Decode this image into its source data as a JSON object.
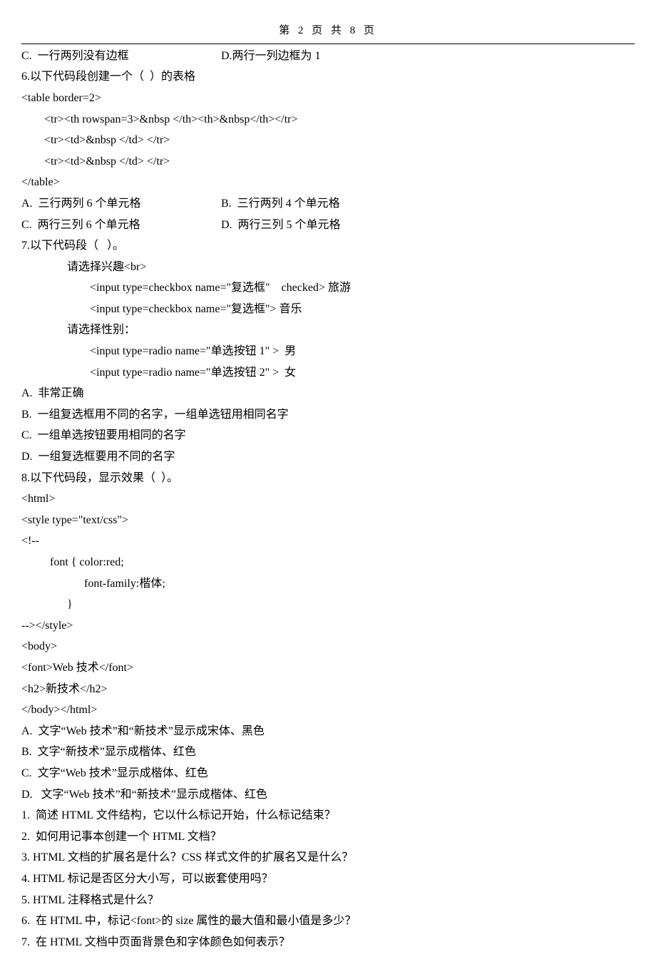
{
  "header": "第 2 页 共 8 页",
  "l1a": "C.  一行两列没有边框",
  "l1b": "D.两行一列边框为 1",
  "l2": "6.以下代码段创建一个（  ）的表格",
  "l3": "<table border=2>",
  "l4": "<tr><th rowspan=3>&nbsp </th><th>&nbsp</th></tr>",
  "l5": "<tr><td>&nbsp </td> </tr>",
  "l6": "<tr><td>&nbsp </td> </tr>",
  "l7": "</table>",
  "l8a": "A.  三行两列 6 个单元格",
  "l8b": "B.  三行两列 4 个单元格",
  "l9a": "C.  两行三列 6 个单元格",
  "l9b": "D.  两行三列 5 个单元格",
  "l10": "7.以下代码段（   ）。",
  "l11": "请选择兴趣<br>",
  "l12": "<input type=checkbox name=\"复选框\"    checked> 旅游",
  "l13": "<input type=checkbox name=\"复选框\"> 音乐",
  "l14": "请选择性别：",
  "l15": "<input type=radio name=\"单选按钮 1\" >  男",
  "l16": "<input type=radio name=\"单选按钮 2\" >  女",
  "l17": "A.  非常正确",
  "l18": "B.  一组复选框用不同的名字，一组单选钮用相同名字",
  "l19": "C.  一组单选按钮要用相同的名字",
  "l20": "D.  一组复选框要用不同的名字",
  "l21": "8.以下代码段，显示效果（  ）。",
  "l22": "<html>",
  "l23": "<style type=\"text/css\">",
  "l24": "<!--",
  "l25": "font { color:red;",
  "l26": "font-family:楷体;",
  "l27": "}",
  "l28": "--></style>",
  "l29": "<body>",
  "l30": "<font>Web 技术</font>",
  "l31": "<h2>新技术</h2>",
  "l32": "</body></html>",
  "l33": "A.  文字“Web 技术”和“新技术”显示成宋体、黑色",
  "l34": "B.  文字“新技术”显示成楷体、红色",
  "l35": "C.  文字“Web 技术”显示成楷体、红色",
  "l36": "D.   文字“Web 技术”和“新技术”显示成楷体、红色",
  "l37": "1.  简述 HTML 文件结构，它以什么标记开始，什么标记结束？",
  "l38": "2.  如何用记事本创建一个 HTML 文档？",
  "l39": "3. HTML 文档的扩展名是什么？CSS 样式文件的扩展名又是什么？",
  "l40": "4. HTML 标记是否区分大小写，可以嵌套使用吗？",
  "l41": "5. HTML 注释格式是什么？",
  "l42": "6.  在 HTML 中，标记<font>的 size 属性的最大值和最小值是多少？",
  "l43": "7.  在 HTML 文档中页面背景色和字体颜色如何表示？"
}
